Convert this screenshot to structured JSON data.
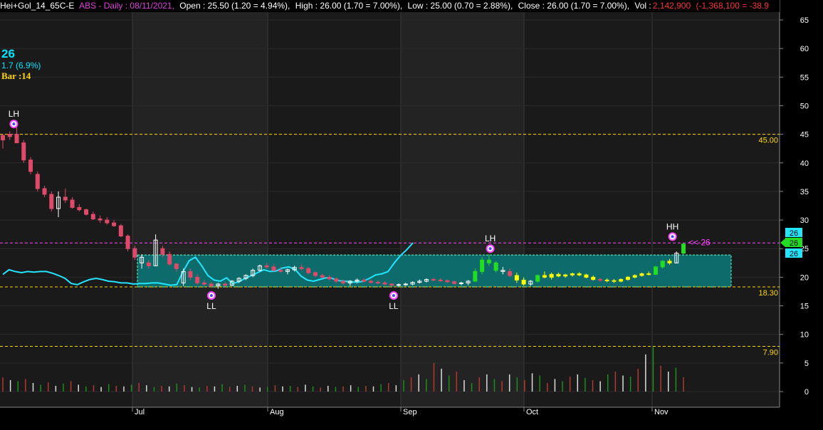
{
  "header": {
    "symbol": "Hei+Gol_14_65C-E",
    "ticker_interval": "ABS - Daily : 08/11/2021,",
    "open": "Open : 25.50 (1.20 = 4.94%),",
    "high": "High : 26.00 (1.70 = 7.00%),",
    "low": "Low : 25.00 (0.70 = 2.88%),",
    "close": "Close : 26.00  (1.70 = 7.00%),",
    "vol_label": "Vol :",
    "vol_value": "2,142,900",
    "vol_change": "(-1,368,100 = -38.9"
  },
  "last": {
    "price": "26",
    "change": "1.7 (6.9%)",
    "bar": "Bar :14"
  },
  "colors": {
    "down": "#e04a6a",
    "up_green": "#22dd22",
    "yellow": "#ffff00",
    "cyan": "#22e5ff",
    "magenta": "#ff44ff",
    "guide_yellow": "#ffd700"
  },
  "chart_data": {
    "type": "candlestick",
    "y_axis": {
      "ticks": [
        65,
        60,
        55,
        50,
        45,
        40,
        35,
        30,
        25,
        20,
        15,
        10,
        5,
        0
      ],
      "range": [
        -2,
        67
      ],
      "side": "right"
    },
    "x_axis": {
      "ticks": [
        "Jul",
        "Aug",
        "Sep",
        "Oct",
        "Nov"
      ]
    },
    "levels": [
      {
        "label": "45.00",
        "value": 45.0,
        "style": "dashed",
        "color": "#ffd700"
      },
      {
        "label": "18.30",
        "value": 18.3,
        "style": "dashed",
        "color": "#ffd700"
      },
      {
        "label": "7.90",
        "value": 7.9,
        "style": "dashed",
        "color": "#ffd700"
      },
      {
        "label": "",
        "value": 26.0,
        "style": "dashed",
        "color": "#ff44ff"
      }
    ],
    "zone": {
      "from": 18.3,
      "to": 23.9,
      "color": "#0e6b6b"
    },
    "price_tags": [
      "26",
      "26",
      "26"
    ],
    "current_marker": "<< 26",
    "pivots": [
      {
        "label": "LH",
        "date_index": 5,
        "value": 46.8,
        "kind": "top"
      },
      {
        "label": "LL",
        "date_index": 95,
        "value": 16.8,
        "kind": "bottom"
      },
      {
        "label": "LL",
        "date_index": 178,
        "value": 16.8,
        "kind": "bottom"
      },
      {
        "label": "LH",
        "date_index": 222,
        "value": 25.0,
        "kind": "top"
      },
      {
        "label": "HH",
        "date_index": 305,
        "value": 27.1,
        "kind": "top"
      }
    ],
    "candles": [
      [
        44.0,
        45.0,
        42.5,
        44.8,
        "d"
      ],
      [
        44.6,
        45.5,
        44.0,
        45.0,
        "d"
      ],
      [
        45.0,
        47.0,
        44.0,
        43.5,
        "d"
      ],
      [
        43.5,
        44.0,
        40.0,
        40.5,
        "d"
      ],
      [
        40.5,
        41.0,
        38.0,
        38.5,
        "d"
      ],
      [
        38.0,
        38.5,
        35.0,
        35.5,
        "d"
      ],
      [
        35.5,
        36.0,
        34.0,
        34.5,
        "d"
      ],
      [
        34.5,
        35.0,
        31.5,
        32.0,
        "d"
      ],
      [
        32.0,
        35.0,
        30.5,
        34.0,
        "u"
      ],
      [
        34.0,
        35.5,
        33.0,
        33.5,
        "d"
      ],
      [
        33.5,
        34.0,
        32.0,
        32.2,
        "d"
      ],
      [
        32.2,
        32.8,
        31.5,
        31.8,
        "d"
      ],
      [
        31.8,
        32.0,
        30.8,
        31.0,
        "d"
      ],
      [
        31.0,
        31.5,
        30.0,
        30.2,
        "d"
      ],
      [
        30.2,
        30.8,
        29.5,
        30.0,
        "d"
      ],
      [
        30.0,
        30.5,
        29.2,
        29.5,
        "d"
      ],
      [
        29.5,
        30.0,
        28.8,
        29.0,
        "d"
      ],
      [
        29.0,
        29.3,
        27.0,
        27.2,
        "d"
      ],
      [
        27.2,
        27.5,
        24.5,
        25.0,
        "d"
      ],
      [
        25.0,
        25.5,
        23.0,
        23.5,
        "d"
      ],
      [
        23.5,
        24.0,
        21.5,
        22.5,
        "u"
      ],
      [
        22.5,
        23.0,
        21.5,
        22.0,
        "d"
      ],
      [
        22.0,
        27.5,
        22.0,
        26.5,
        "u"
      ],
      [
        25.0,
        25.5,
        23.5,
        24.0,
        "d"
      ],
      [
        24.0,
        24.5,
        22.0,
        22.3,
        "d"
      ],
      [
        22.3,
        22.5,
        21.0,
        21.5,
        "d"
      ],
      [
        19.0,
        21.5,
        18.5,
        21.0,
        "u"
      ],
      [
        21.0,
        21.5,
        19.5,
        20.0,
        "d"
      ],
      [
        20.0,
        20.5,
        18.7,
        19.0,
        "d"
      ],
      [
        19.0,
        19.5,
        18.5,
        18.8,
        "d"
      ],
      [
        18.8,
        19.2,
        18.2,
        18.5,
        "d"
      ],
      [
        18.5,
        19.0,
        18.0,
        18.8,
        "u"
      ],
      [
        18.8,
        19.2,
        18.4,
        18.6,
        "d"
      ],
      [
        18.6,
        19.5,
        18.5,
        19.3,
        "u"
      ],
      [
        19.3,
        20.0,
        19.0,
        19.8,
        "u"
      ],
      [
        19.8,
        20.5,
        19.5,
        20.3,
        "u"
      ],
      [
        20.3,
        21.5,
        20.0,
        21.2,
        "u"
      ],
      [
        21.2,
        22.2,
        21.0,
        22.0,
        "u"
      ],
      [
        22.0,
        22.5,
        21.5,
        21.8,
        "d"
      ],
      [
        21.8,
        22.3,
        21.0,
        21.2,
        "d"
      ],
      [
        21.2,
        21.8,
        20.8,
        21.0,
        "d"
      ],
      [
        21.0,
        21.5,
        20.5,
        21.3,
        "u"
      ],
      [
        21.3,
        22.0,
        21.0,
        21.7,
        "u"
      ],
      [
        21.7,
        22.2,
        21.2,
        21.5,
        "d"
      ],
      [
        21.5,
        21.8,
        20.5,
        20.8,
        "d"
      ],
      [
        20.8,
        21.0,
        20.0,
        20.3,
        "d"
      ],
      [
        20.3,
        20.6,
        19.8,
        20.0,
        "d"
      ],
      [
        20.0,
        20.3,
        19.5,
        19.7,
        "d"
      ],
      [
        19.7,
        20.0,
        19.0,
        19.3,
        "d"
      ],
      [
        19.3,
        19.6,
        18.7,
        19.0,
        "d"
      ],
      [
        19.0,
        19.5,
        18.5,
        19.3,
        "u"
      ],
      [
        19.3,
        19.8,
        19.0,
        19.5,
        "u"
      ],
      [
        19.5,
        19.8,
        19.1,
        19.3,
        "d"
      ],
      [
        19.3,
        19.6,
        18.9,
        19.1,
        "d"
      ],
      [
        19.1,
        19.4,
        18.8,
        19.0,
        "d"
      ],
      [
        19.0,
        19.3,
        18.6,
        18.8,
        "d"
      ],
      [
        18.8,
        19.0,
        18.4,
        18.6,
        "d"
      ],
      [
        18.6,
        18.9,
        18.4,
        18.7,
        "u"
      ],
      [
        18.7,
        19.0,
        18.5,
        18.8,
        "u"
      ],
      [
        18.8,
        19.3,
        18.6,
        19.1,
        "u"
      ],
      [
        19.1,
        19.6,
        18.9,
        19.3,
        "u"
      ],
      [
        19.3,
        19.8,
        19.1,
        19.6,
        "u"
      ],
      [
        19.6,
        19.9,
        19.3,
        19.5,
        "d"
      ],
      [
        19.5,
        19.8,
        19.2,
        19.4,
        "d"
      ],
      [
        19.4,
        19.6,
        19.0,
        19.2,
        "d"
      ],
      [
        19.2,
        19.4,
        18.7,
        18.9,
        "d"
      ],
      [
        18.9,
        19.2,
        18.6,
        19.0,
        "u"
      ],
      [
        19.0,
        19.5,
        18.6,
        19.3,
        "u"
      ],
      [
        19.3,
        21.5,
        19.2,
        21.0,
        "g"
      ],
      [
        21.0,
        23.5,
        20.5,
        23.0,
        "g"
      ],
      [
        23.0,
        24.0,
        22.0,
        22.5,
        "g"
      ],
      [
        22.5,
        22.8,
        20.8,
        21.2,
        "g"
      ],
      [
        21.2,
        21.8,
        20.5,
        21.0,
        "u"
      ],
      [
        21.0,
        21.5,
        20.0,
        20.3,
        "d"
      ],
      [
        20.3,
        20.8,
        19.0,
        19.5,
        "y"
      ],
      [
        19.5,
        20.0,
        18.5,
        18.8,
        "y"
      ],
      [
        18.8,
        19.5,
        18.5,
        19.3,
        "u"
      ],
      [
        19.3,
        20.5,
        19.0,
        20.3,
        "g"
      ],
      [
        20.3,
        21.0,
        19.8,
        20.0,
        "y"
      ],
      [
        20.0,
        20.8,
        19.6,
        20.5,
        "y"
      ],
      [
        20.5,
        20.8,
        20.0,
        20.2,
        "y"
      ],
      [
        20.2,
        20.6,
        19.9,
        20.4,
        "y"
      ],
      [
        20.4,
        20.8,
        20.1,
        20.6,
        "y"
      ],
      [
        20.6,
        20.9,
        20.2,
        20.4,
        "y"
      ],
      [
        20.4,
        20.6,
        19.8,
        20.0,
        "y"
      ],
      [
        20.0,
        20.3,
        19.4,
        19.6,
        "y"
      ],
      [
        19.6,
        19.9,
        19.2,
        19.5,
        "d"
      ],
      [
        19.5,
        19.8,
        19.1,
        19.4,
        "y"
      ],
      [
        19.4,
        19.7,
        19.0,
        19.3,
        "y"
      ],
      [
        19.3,
        19.8,
        19.1,
        19.6,
        "y"
      ],
      [
        19.6,
        20.2,
        19.4,
        20.0,
        "y"
      ],
      [
        20.0,
        20.5,
        19.8,
        20.3,
        "y"
      ],
      [
        20.3,
        20.8,
        20.1,
        20.6,
        "y"
      ],
      [
        20.6,
        21.0,
        20.3,
        20.5,
        "y"
      ],
      [
        20.5,
        22.0,
        20.4,
        21.8,
        "g"
      ],
      [
        21.8,
        23.0,
        21.5,
        22.8,
        "g"
      ],
      [
        22.8,
        23.2,
        22.2,
        22.5,
        "y"
      ],
      [
        22.5,
        24.5,
        22.4,
        24.2,
        "u"
      ],
      [
        24.2,
        26.0,
        24.0,
        25.8,
        "g"
      ]
    ],
    "candle_x_start": 4,
    "candle_x_end": 960,
    "ma_line": [
      [
        20.5,
        21.3,
        21.0,
        20.8,
        21.0,
        20.9,
        21.0,
        21.0,
        20.7,
        20.3,
        19.8,
        18.9,
        18.7,
        19.2,
        19.6,
        19.8,
        19.6,
        19.3,
        19.2,
        19.0,
        19.0,
        18.8,
        18.9,
        18.9,
        19.0,
        19.0,
        18.8,
        18.6,
        18.7,
        21.0,
        22.9,
        23.5,
        22.0,
        20.3,
        19.5,
        19.3,
        19.9,
        18.9,
        19.2,
        19.8,
        20.3,
        20.8,
        21.3,
        21.0,
        21.1,
        21.6,
        21.8,
        21.4,
        20.2,
        19.5,
        19.3,
        19.6,
        19.9,
        19.8,
        19.4,
        19.3,
        19.2,
        19.1,
        19.3,
        19.8,
        20.4,
        20.6,
        21.0,
        22.5,
        23.8,
        24.8,
        26.0
      ]
    ],
    "ma_x_start": 4,
    "ma_x_end": 580,
    "volumes": [
      2.5,
      2.0,
      1.8,
      2.2,
      1.5,
      1.2,
      1.6,
      1.0,
      1.4,
      1.8,
      1.2,
      0.9,
      1.1,
      0.8,
      1.3,
      1.0,
      0.9,
      1.2,
      1.5,
      1.1,
      0.8,
      1.0,
      0.9,
      1.4,
      1.1,
      0.8,
      0.7,
      1.0,
      0.9,
      1.3,
      0.8,
      1.0,
      1.2,
      0.9,
      0.7,
      0.8,
      1.1,
      0.9,
      1.0,
      0.8,
      1.2,
      0.9,
      0.7,
      1.0,
      0.8,
      0.9,
      1.1,
      0.8,
      1.0,
      0.9,
      1.3,
      1.5,
      1.1,
      2.0,
      2.5,
      3.0,
      2.2,
      5.0,
      4.0,
      2.8,
      3.5,
      2.0,
      1.5,
      2.5,
      3.0,
      2.2,
      1.8,
      3.0,
      2.5,
      2.0,
      3.2,
      2.8,
      1.5,
      2.2,
      1.8,
      2.6,
      3.0,
      2.4,
      2.0,
      1.8,
      3.0,
      3.5,
      2.8,
      2.6,
      4.0,
      6.5,
      7.8,
      4.5,
      3.5,
      4.2,
      2.5
    ]
  }
}
